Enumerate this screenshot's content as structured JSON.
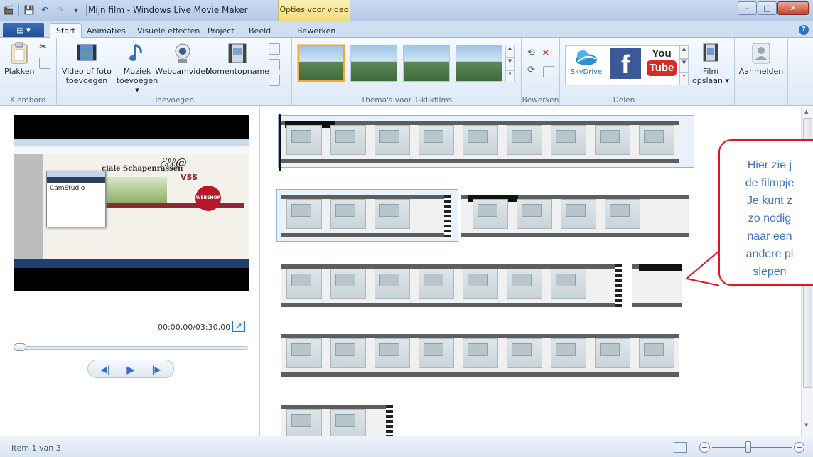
{
  "window": {
    "title": "Mijn film - Windows Live Movie Maker",
    "contextual_tab": "Opties voor video",
    "minimize": "–",
    "maximize": "□",
    "close": "✕"
  },
  "ribbon_tabs": [
    "Start",
    "Animaties",
    "Visuele effecten",
    "Project",
    "Beeld",
    "Bewerken"
  ],
  "app_button": "▤ ▾",
  "groups": {
    "klembord": {
      "label": "Klembord",
      "paste": "Plakken"
    },
    "toevoegen": {
      "label": "Toevoegen",
      "video_line1": "Video of foto",
      "video_line2": "toevoegen",
      "music_line1": "Muziek",
      "music_line2": "toevoegen ▾",
      "webcam": "Webcamvideo",
      "snapshot": "Momentopname"
    },
    "themes": {
      "label": "Thema's voor 1-klikfilms"
    },
    "bewerken": {
      "label": "Bewerken"
    },
    "delen": {
      "label": "Delen",
      "skydrive": "SkyDrive",
      "youtube_line1": "You",
      "youtube_line2": "Tube"
    },
    "save": {
      "line1": "Film",
      "line2": "opslaan ▾"
    },
    "signin": {
      "label": "Aanmelden"
    }
  },
  "preview": {
    "timecode": "00:00,00/03:30,00",
    "progress": 0,
    "screenshot_text": {
      "logo": "ciale Schapenrassen",
      "camstudio": "CamStudio",
      "webshop": "WEBSHOP",
      "vss": "VSS"
    }
  },
  "callout": {
    "lines": [
      "Hier zie j",
      "de filmpje",
      "Je kunt z",
      "zo nodig",
      "naar een",
      "andere pl",
      "slepen"
    ]
  },
  "status": {
    "item": "Item 1 van 3",
    "zoom_level": 0.45
  },
  "colors": {
    "callout_border": "#e3141b",
    "callout_text": "#3f74c1",
    "accent": "#2f6fc4"
  }
}
